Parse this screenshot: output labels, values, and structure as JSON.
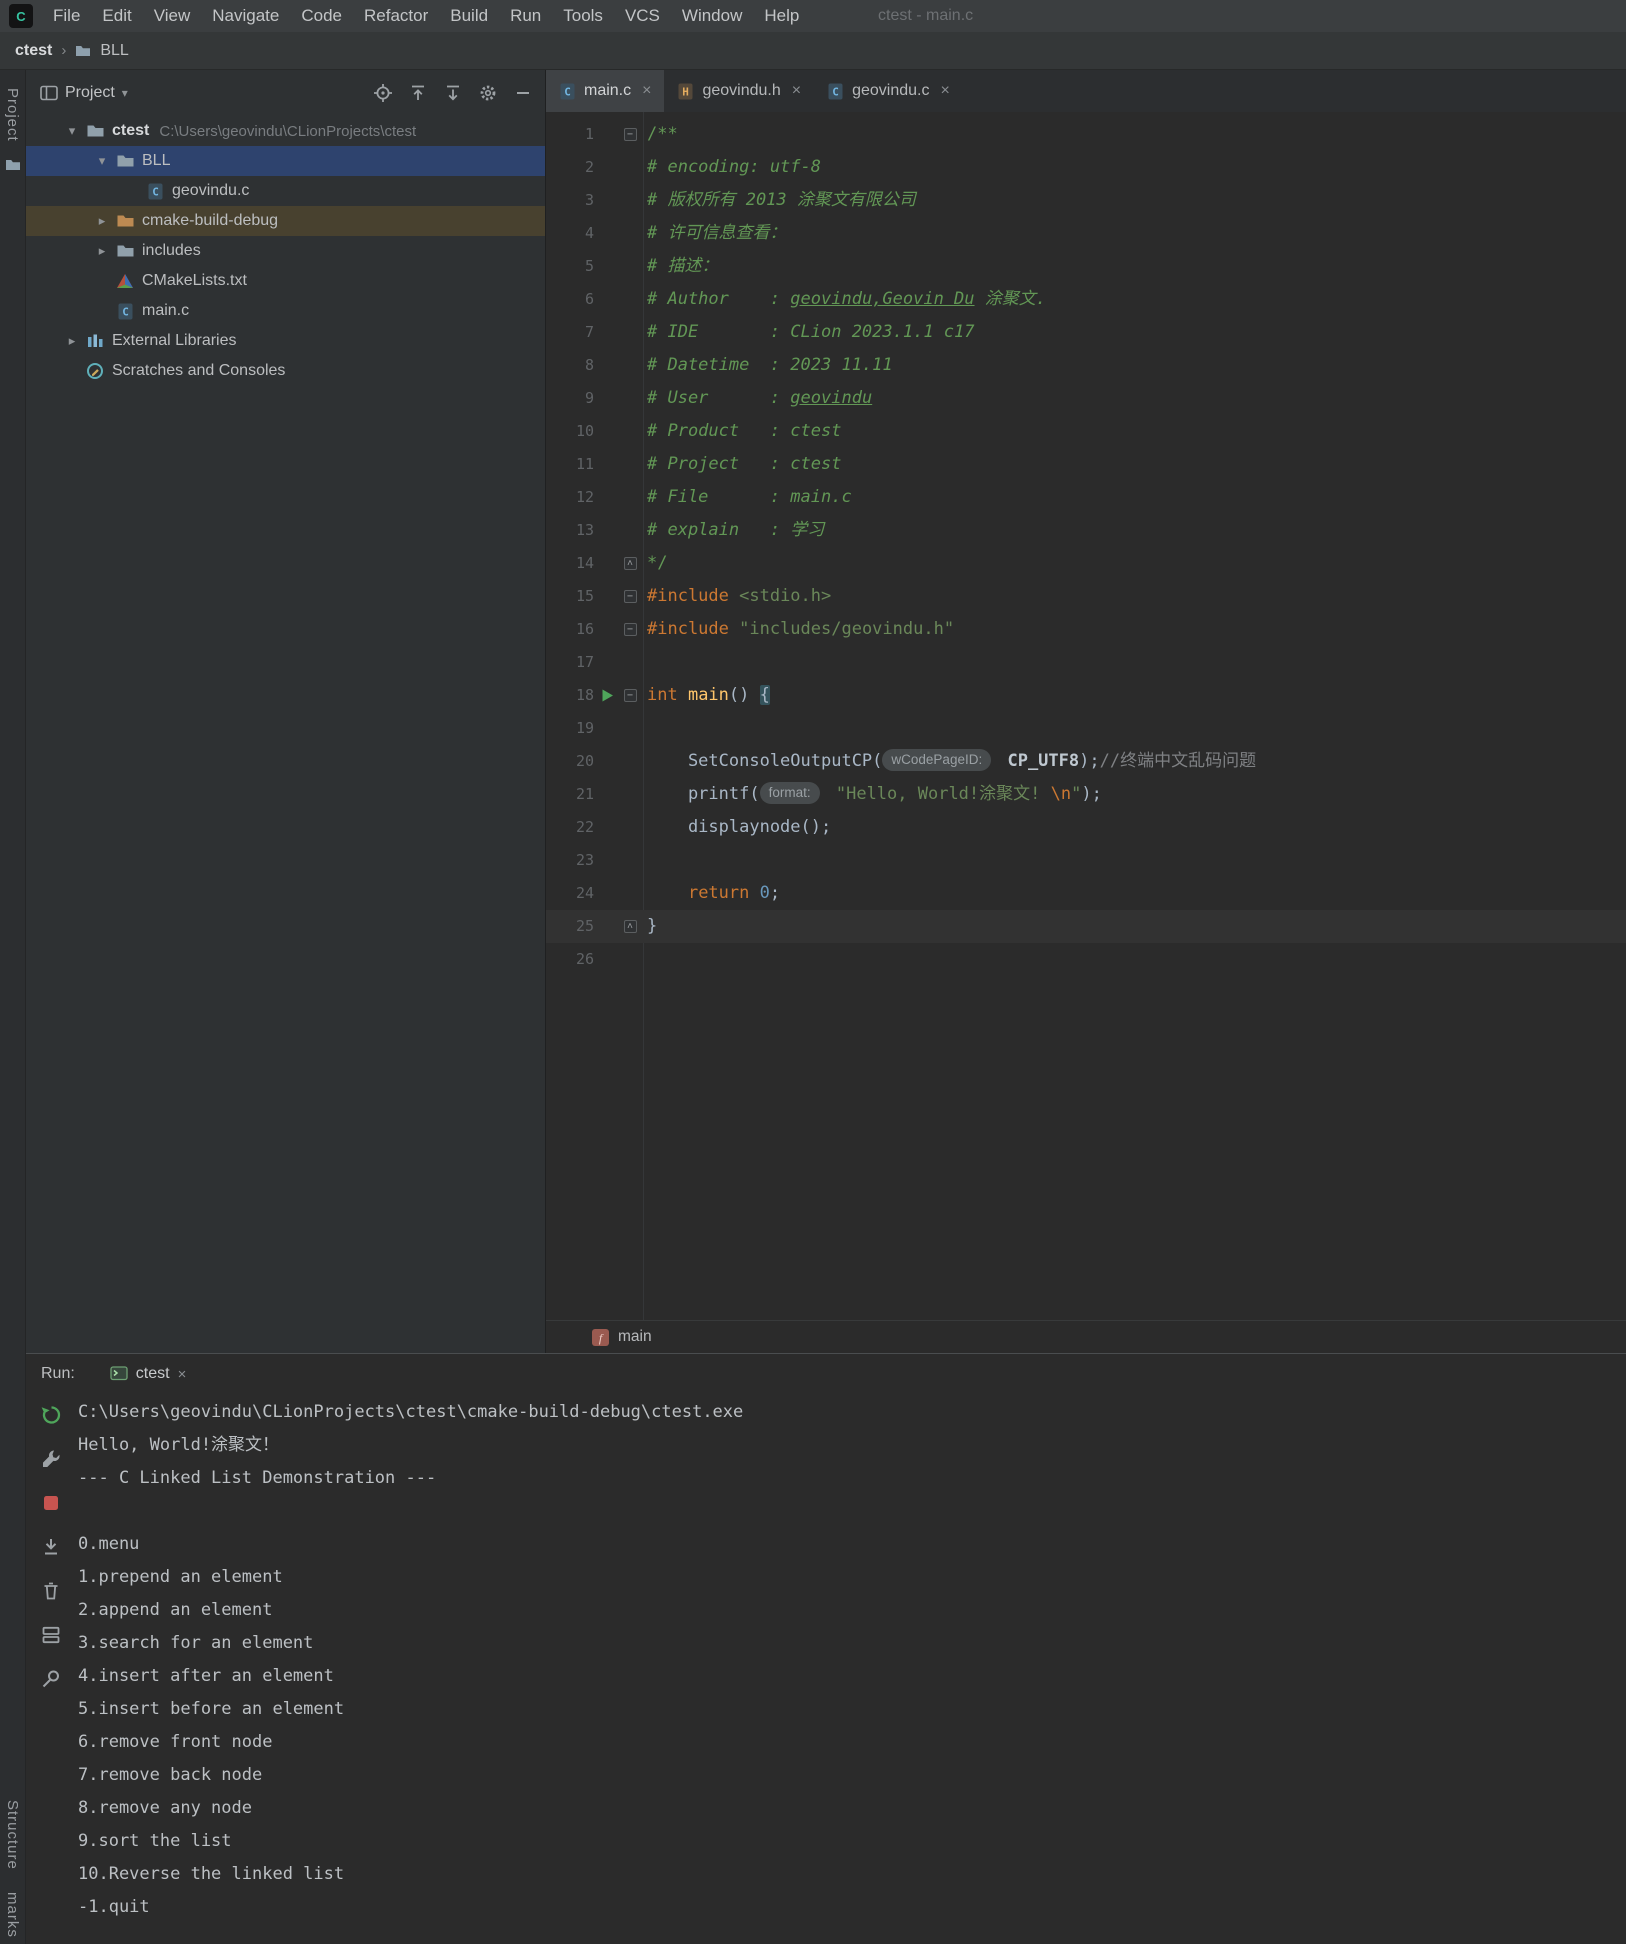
{
  "window": {
    "title": "ctest - main.c"
  },
  "menu": {
    "items": [
      "File",
      "Edit",
      "View",
      "Navigate",
      "Code",
      "Refactor",
      "Build",
      "Run",
      "Tools",
      "VCS",
      "Window",
      "Help"
    ]
  },
  "breadcrumb": {
    "project": "ctest",
    "folder": "BLL"
  },
  "left_stripe": {
    "top_label": "Project",
    "bottom_labels": [
      "Structure",
      "marks"
    ]
  },
  "project_panel": {
    "title": "Project",
    "toolbar_icons": [
      "locate-file",
      "scroll-from-source",
      "collapse-all",
      "settings",
      "hide"
    ],
    "tree": [
      {
        "label": "ctest",
        "hint": "C:\\Users\\geovindu\\CLionProjects\\ctest",
        "level": 0,
        "chevron": "down",
        "icon": "folder",
        "bold": true
      },
      {
        "label": "BLL",
        "level": 1,
        "chevron": "down",
        "icon": "folder",
        "selected": true
      },
      {
        "label": "geovindu.c",
        "level": 2,
        "icon": "c-file"
      },
      {
        "label": "cmake-build-debug",
        "level": 1,
        "chevron": "right",
        "icon": "folder-excluded",
        "highlight": true
      },
      {
        "label": "includes",
        "level": 1,
        "chevron": "right",
        "icon": "folder"
      },
      {
        "label": "CMakeLists.txt",
        "level": 1,
        "icon": "cmake-file"
      },
      {
        "label": "main.c",
        "level": 1,
        "icon": "c-file"
      },
      {
        "label": "External Libraries",
        "level": 0,
        "chevron": "right",
        "icon": "libraries"
      },
      {
        "label": "Scratches and Consoles",
        "level": 0,
        "icon": "scratches"
      }
    ]
  },
  "editor": {
    "tabs": [
      {
        "label": "main.c",
        "icon": "c-file",
        "active": true
      },
      {
        "label": "geovindu.h",
        "icon": "h-file",
        "active": false
      },
      {
        "label": "geovindu.c",
        "icon": "c-file",
        "active": false
      }
    ],
    "breadcrumb_label": "main",
    "lines": [
      {
        "n": 1,
        "fold": "minus",
        "seg": [
          [
            "cm",
            "/**"
          ]
        ]
      },
      {
        "n": 2,
        "seg": [
          [
            "cmi",
            "# encoding: utf-8"
          ]
        ]
      },
      {
        "n": 3,
        "seg": [
          [
            "cmi",
            "# 版权所有 2013 涂聚文有限公司"
          ]
        ]
      },
      {
        "n": 4,
        "seg": [
          [
            "cmi",
            "# 许可信息查看："
          ]
        ]
      },
      {
        "n": 5,
        "seg": [
          [
            "cmi",
            "# 描述："
          ]
        ]
      },
      {
        "n": 6,
        "seg": [
          [
            "cmi",
            "# Author    : "
          ],
          [
            "cmi u",
            "geovindu,Geovin Du"
          ],
          [
            "cmi",
            " 涂聚文."
          ]
        ]
      },
      {
        "n": 7,
        "seg": [
          [
            "cmi",
            "# IDE       : CLion 2023.1.1 c17"
          ]
        ]
      },
      {
        "n": 8,
        "seg": [
          [
            "cmi",
            "# Datetime  : 2023 11.11"
          ]
        ]
      },
      {
        "n": 9,
        "seg": [
          [
            "cmi",
            "# User      : "
          ],
          [
            "cmi u",
            "geovindu"
          ]
        ]
      },
      {
        "n": 10,
        "seg": [
          [
            "cmi",
            "# Product   : ctest"
          ]
        ]
      },
      {
        "n": 11,
        "seg": [
          [
            "cmi",
            "# Project   : ctest"
          ]
        ]
      },
      {
        "n": 12,
        "seg": [
          [
            "cmi",
            "# File      : main.c"
          ]
        ]
      },
      {
        "n": 13,
        "seg": [
          [
            "cmi",
            "# explain   : 学习"
          ]
        ]
      },
      {
        "n": 14,
        "fold": "up",
        "seg": [
          [
            "cm",
            "*/"
          ]
        ]
      },
      {
        "n": 15,
        "fold": "minus",
        "seg": [
          [
            "kw",
            "#include "
          ],
          [
            "str",
            "<stdio.h>"
          ]
        ]
      },
      {
        "n": 16,
        "fold": "minus",
        "seg": [
          [
            "kw",
            "#include "
          ],
          [
            "str",
            "\"includes/geovindu.h\""
          ]
        ]
      },
      {
        "n": 17,
        "seg": []
      },
      {
        "n": 18,
        "gutter": "play",
        "fold": "minus",
        "seg": [
          [
            "kw",
            "int "
          ],
          [
            "fn",
            "main"
          ],
          [
            "pl",
            "() "
          ],
          [
            "pl brace",
            "{"
          ]
        ]
      },
      {
        "n": 19,
        "seg": []
      },
      {
        "n": 20,
        "seg": [
          [
            "pl",
            "    SetConsoleOutputCP("
          ],
          [
            "hint",
            "wCodePageID:"
          ],
          [
            "pl",
            " "
          ],
          [
            "const",
            "CP_UTF8"
          ],
          [
            "pl",
            ");"
          ],
          [
            "lc",
            "//终端中文乱码问题"
          ]
        ]
      },
      {
        "n": 21,
        "seg": [
          [
            "pl",
            "    printf("
          ],
          [
            "hint",
            "format:"
          ],
          [
            "pl",
            " "
          ],
          [
            "str",
            "\"Hello, World!涂聚文! "
          ],
          [
            "esc",
            "\\n"
          ],
          [
            "str",
            "\""
          ],
          [
            "pl",
            ");"
          ]
        ]
      },
      {
        "n": 22,
        "seg": [
          [
            "pl",
            "    displaynode();"
          ]
        ]
      },
      {
        "n": 23,
        "seg": []
      },
      {
        "n": 24,
        "seg": [
          [
            "pl",
            "    "
          ],
          [
            "kw",
            "return "
          ],
          [
            "num",
            "0"
          ],
          [
            "pl",
            ";"
          ]
        ]
      },
      {
        "n": 25,
        "cur": true,
        "fold": "up",
        "seg": [
          [
            "pl",
            "}"
          ]
        ]
      },
      {
        "n": 26,
        "seg": []
      }
    ]
  },
  "run_panel": {
    "label": "Run:",
    "tab_label": "ctest",
    "toolbar_icons": [
      "rerun",
      "build-settings",
      "stop",
      "scroll-to-end",
      "clear-all",
      "restore-layout",
      "pin"
    ],
    "console_lines": [
      "C:\\Users\\geovindu\\CLionProjects\\ctest\\cmake-build-debug\\ctest.exe",
      "Hello, World!涂聚文！",
      "--- C Linked List Demonstration ---",
      "",
      "0.menu",
      "1.prepend an element",
      "2.append an element",
      "3.search for an element",
      "4.insert after an element",
      "5.insert before an element",
      "6.remove front node",
      "7.remove back node",
      "8.remove any node",
      "9.sort the list",
      "10.Reverse the linked list",
      "-1.quit"
    ]
  }
}
